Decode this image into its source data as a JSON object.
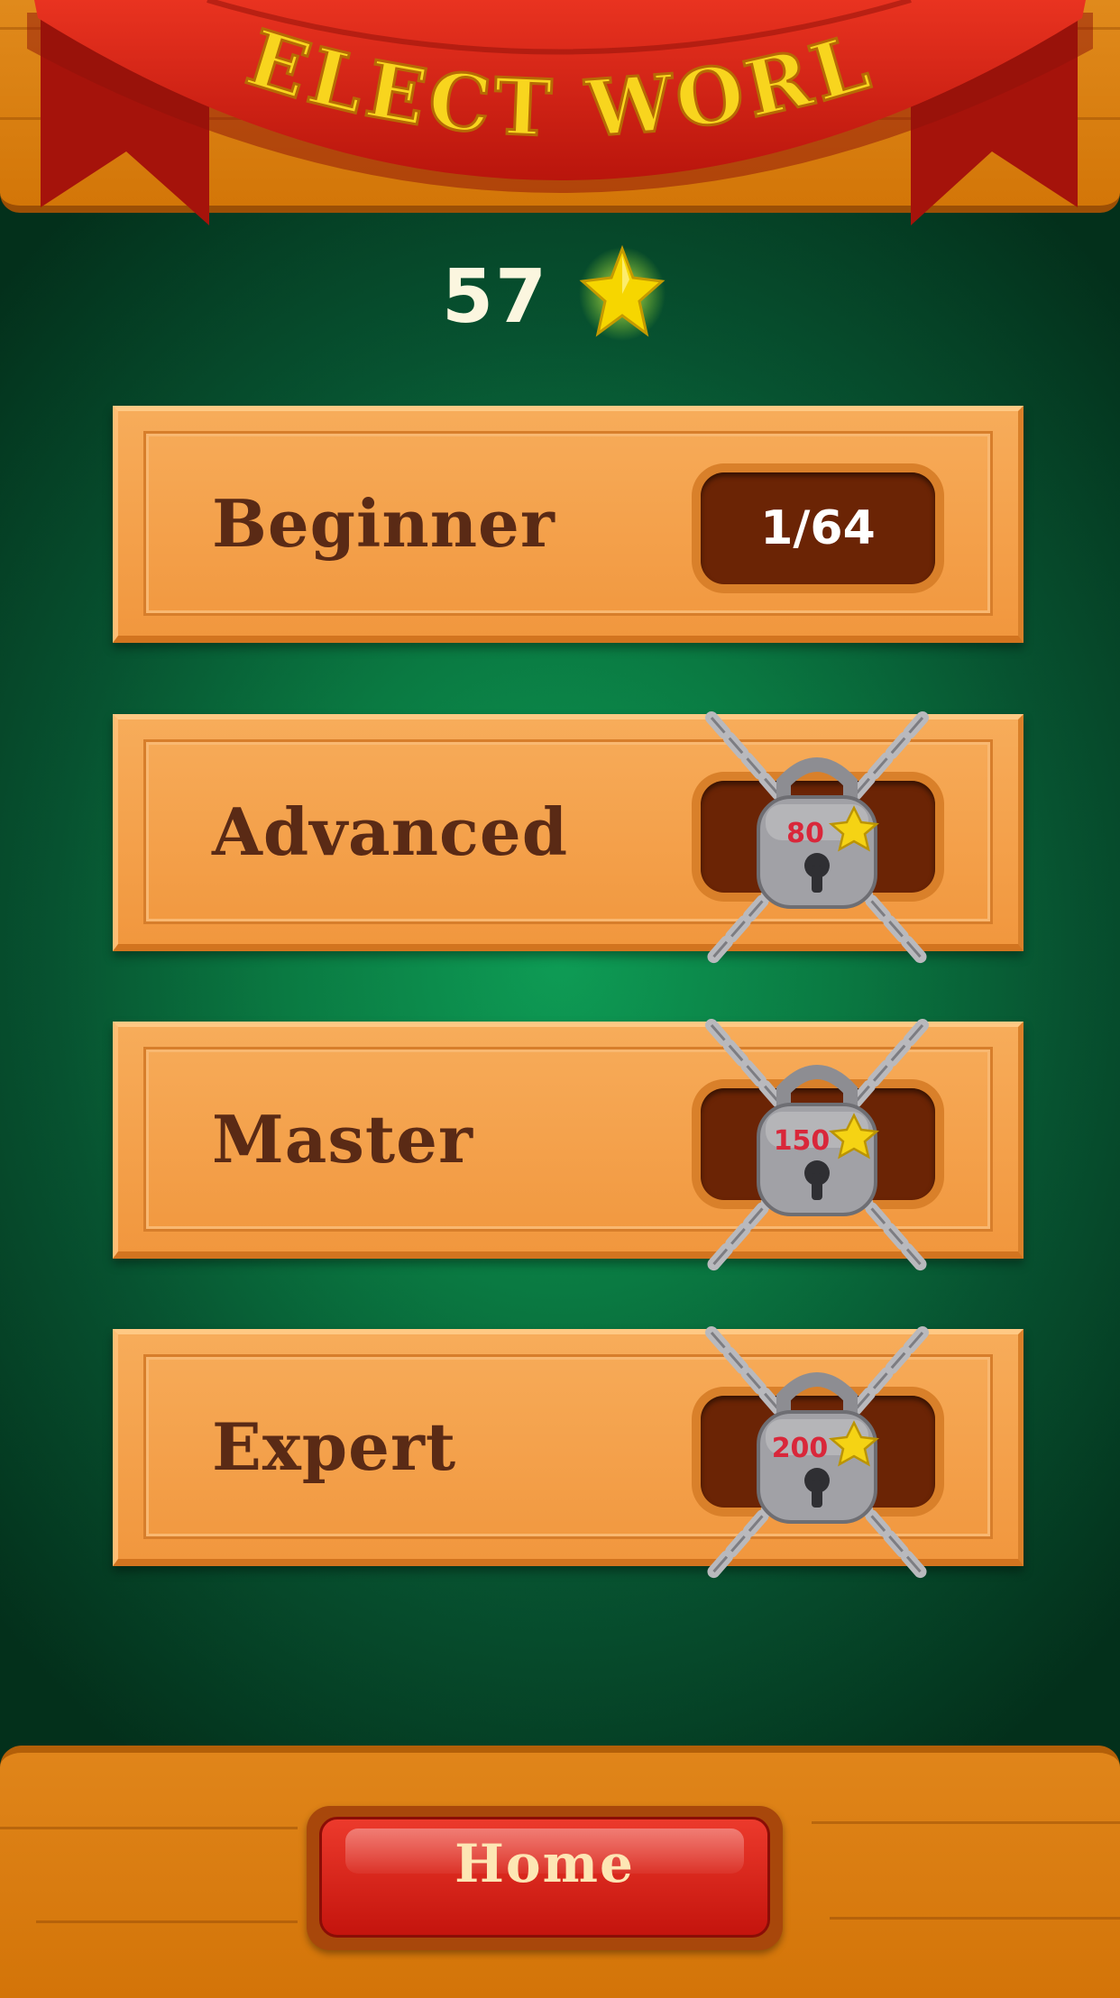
{
  "header": {
    "title": "SELECT WORLD"
  },
  "stars": {
    "count": "57",
    "icon": "star-icon"
  },
  "worlds": [
    {
      "name": "Beginner",
      "progress": "1/64",
      "locked": false
    },
    {
      "name": "Advanced",
      "required_stars": "80",
      "locked": true
    },
    {
      "name": "Master",
      "required_stars": "150",
      "locked": true
    },
    {
      "name": "Expert",
      "required_stars": "200",
      "locked": true
    }
  ],
  "footer": {
    "home_label": "Home"
  },
  "colors": {
    "banner_red": "#d61e12",
    "title_yellow": "#f7d21c",
    "wood": "#f1973e",
    "slot": "#6b2405",
    "lock_number": "#d9273a"
  }
}
